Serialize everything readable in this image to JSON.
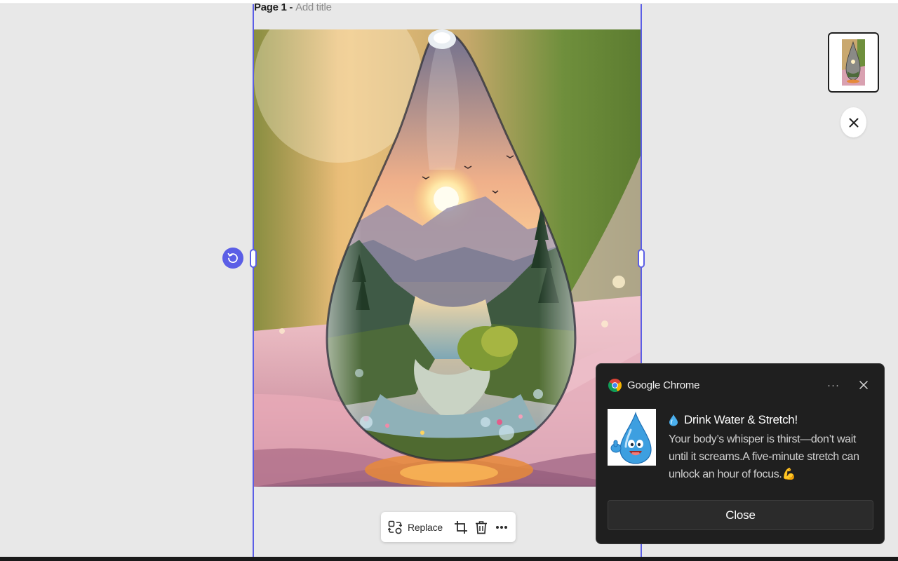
{
  "page": {
    "label": "Page 1 -",
    "title_placeholder": "Add title"
  },
  "toolbar": {
    "replace_label": "Replace",
    "icons": [
      "replace-icon",
      "crop-icon",
      "trash-icon",
      "more-icon"
    ]
  },
  "notification": {
    "app_name": "Google Chrome",
    "more_label": "···",
    "title": "Drink Water & Stretch!",
    "body": "Your body’s whisper is thirst—don’t wait until it screams.A five-minute stretch can unlock an hour of focus.💪",
    "close_label": "Close"
  },
  "colors": {
    "accent": "#5b5ee6",
    "canvas_bg": "#e8e8e8",
    "notification_bg": "#1f1f1f",
    "notification_button": "#2b2b2b"
  }
}
